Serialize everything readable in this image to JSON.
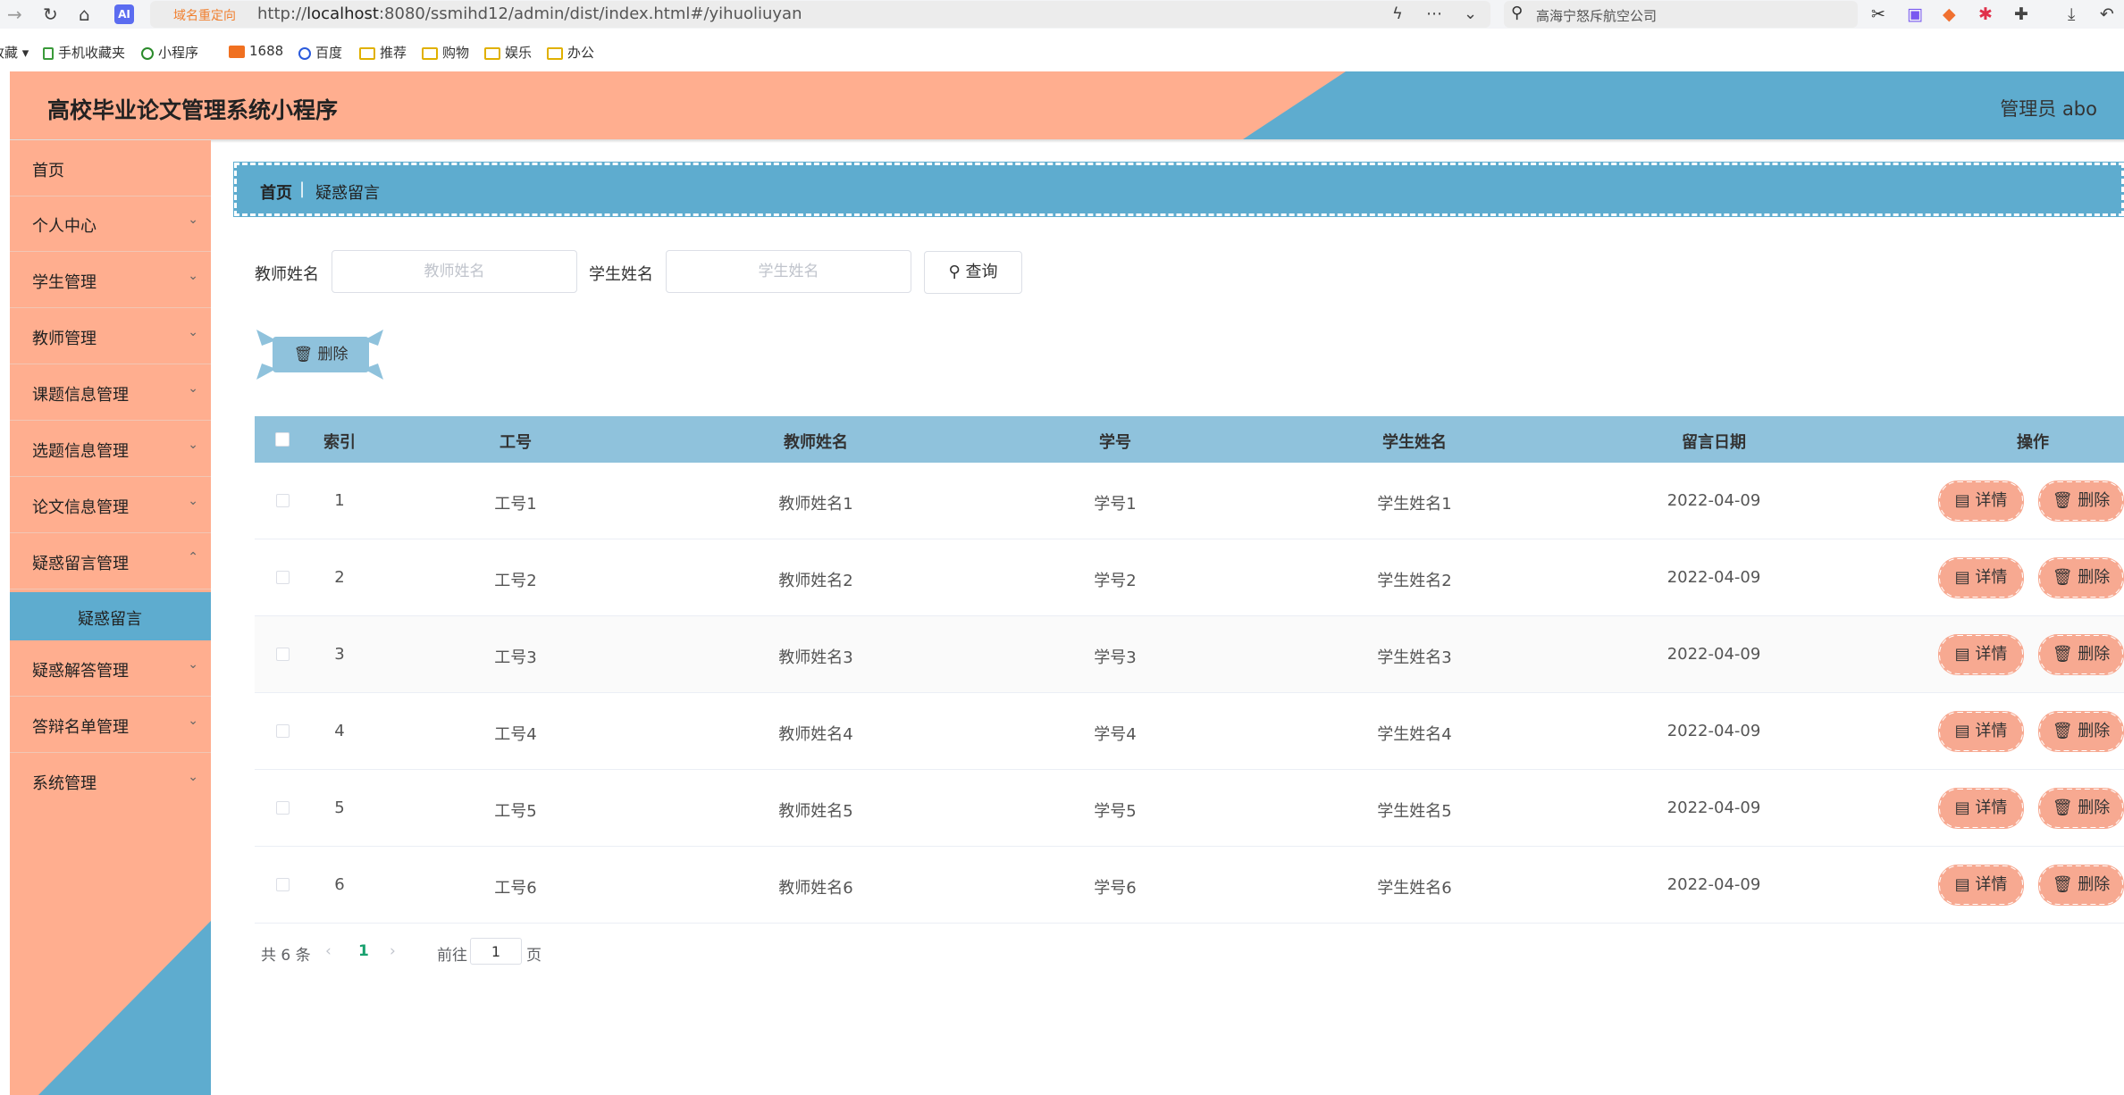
{
  "browser": {
    "redirect_label": "域名重定向",
    "url_prefix": "http://",
    "url_host": "localhost",
    "url_rest": ":8080/ssmihd12/admin/dist/index.html#/yihuoliuyan",
    "search_text": "高海宁怒斥航空公司",
    "ai_label": "AI",
    "bookmarks": [
      {
        "label": "收藏"
      },
      {
        "label": "手机收藏夹"
      },
      {
        "label": "小程序"
      },
      {
        "label": "1688"
      },
      {
        "label": "百度"
      },
      {
        "label": "推荐"
      },
      {
        "label": "购物"
      },
      {
        "label": "娱乐"
      },
      {
        "label": "办公"
      }
    ]
  },
  "header": {
    "title": "高校毕业论文管理系统小程序",
    "admin": "管理员 abo"
  },
  "sidebar": {
    "items": [
      {
        "label": "首页"
      },
      {
        "label": "个人中心"
      },
      {
        "label": "学生管理"
      },
      {
        "label": "教师管理"
      },
      {
        "label": "课题信息管理"
      },
      {
        "label": "选题信息管理"
      },
      {
        "label": "论文信息管理"
      },
      {
        "label": "疑惑留言管理"
      },
      {
        "label": "疑惑解答管理"
      },
      {
        "label": "答辩名单管理"
      },
      {
        "label": "系统管理"
      }
    ],
    "active_sub": "疑惑留言"
  },
  "breadcrumb": {
    "home": "首页",
    "separator": "|",
    "current": "疑惑留言"
  },
  "search": {
    "teacher_label": "教师姓名",
    "teacher_placeholder": "教师姓名",
    "student_label": "学生姓名",
    "student_placeholder": "学生姓名",
    "query_label": "查询"
  },
  "actions": {
    "delete_label": "删除"
  },
  "table": {
    "headers": [
      "索引",
      "工号",
      "教师姓名",
      "学号",
      "学生姓名",
      "留言日期",
      "操作"
    ],
    "rows": [
      {
        "index": "1",
        "work_no": "工号1",
        "teacher": "教师姓名1",
        "student_no": "学号1",
        "student": "学生姓名1",
        "date": "2022-04-09"
      },
      {
        "index": "2",
        "work_no": "工号2",
        "teacher": "教师姓名2",
        "student_no": "学号2",
        "student": "学生姓名2",
        "date": "2022-04-09"
      },
      {
        "index": "3",
        "work_no": "工号3",
        "teacher": "教师姓名3",
        "student_no": "学号3",
        "student": "学生姓名3",
        "date": "2022-04-09"
      },
      {
        "index": "4",
        "work_no": "工号4",
        "teacher": "教师姓名4",
        "student_no": "学号4",
        "student": "学生姓名4",
        "date": "2022-04-09"
      },
      {
        "index": "5",
        "work_no": "工号5",
        "teacher": "教师姓名5",
        "student_no": "学号5",
        "student": "学生姓名5",
        "date": "2022-04-09"
      },
      {
        "index": "6",
        "work_no": "工号6",
        "teacher": "教师姓名6",
        "student_no": "学号6",
        "student": "学生姓名6",
        "date": "2022-04-09"
      }
    ],
    "detail_label": "详情",
    "delete_label": "删除"
  },
  "pagination": {
    "total": "共 6 条",
    "current_page": "1",
    "goto_label": "前往",
    "goto_value": "1",
    "page_suffix": "页"
  },
  "colors": {
    "accent_salmon": "#ffae8f",
    "accent_blue": "#5eaccf",
    "table_header": "#8fc2dc",
    "op_button": "#f7a991",
    "active_page": "#19a16f"
  }
}
